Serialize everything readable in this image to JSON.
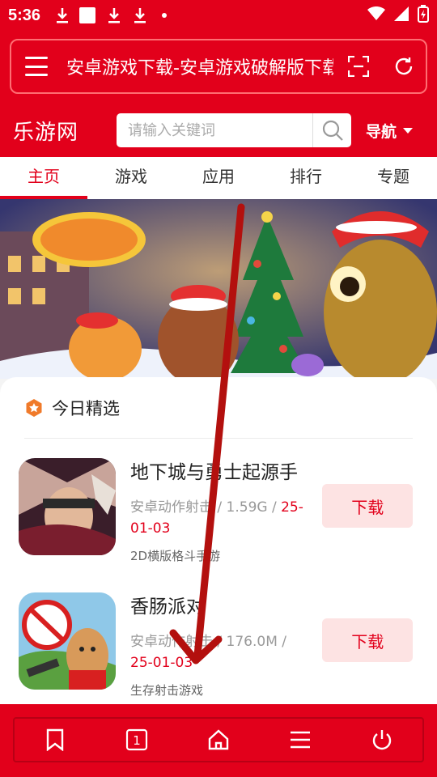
{
  "status_bar": {
    "time": "5:36",
    "icons": [
      "download-icon",
      "download-icon",
      "square-icon",
      "download-icon",
      "download-icon",
      "dot-icon",
      "wifi-icon",
      "signal-icon",
      "battery-icon"
    ]
  },
  "browser": {
    "page_title": "安卓游戏下载-安卓游戏破解版下载"
  },
  "site": {
    "logo": "乐游网",
    "search_placeholder": "请输入关键词",
    "nav_label": "导航"
  },
  "tabs": [
    {
      "label": "主页"
    },
    {
      "label": "游戏"
    },
    {
      "label": "应用"
    },
    {
      "label": "排行"
    },
    {
      "label": "专题"
    }
  ],
  "section": {
    "title": "今日精选"
  },
  "apps": [
    {
      "name": "地下城与勇士起源手",
      "meta": "安卓动作射击 / 1.59G / ",
      "date": "25-01-03",
      "desc": "2D横版格斗手游",
      "button": "下载"
    },
    {
      "name": "香肠派对",
      "meta": "安卓动作射击 / 176.0M / ",
      "date": "25-01-03",
      "desc": "生存射击游戏",
      "button": "下载"
    }
  ],
  "colors": {
    "brand": "#e2001b",
    "button_bg": "#fde3e3",
    "gesture_arrow": "#b3100e"
  }
}
